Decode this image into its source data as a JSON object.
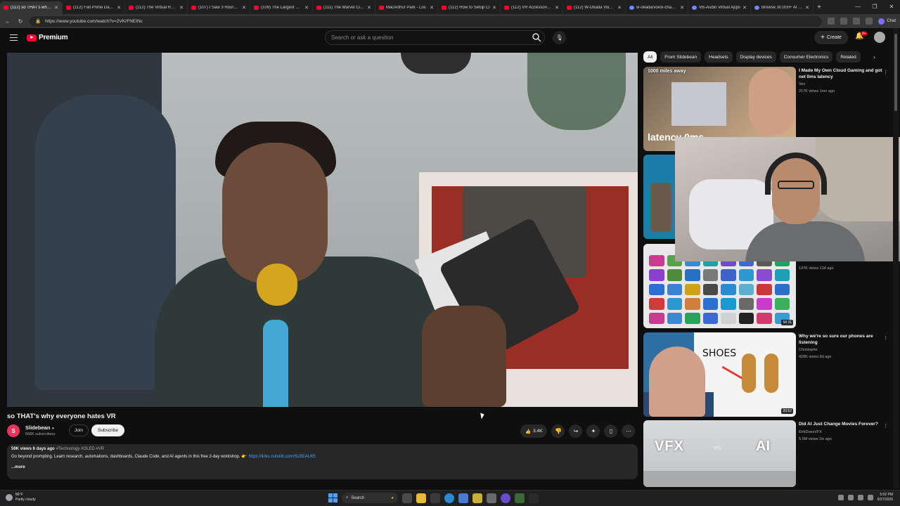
{
  "browser": {
    "tabs": [
      {
        "title": "(112) so THAT's why...",
        "active": true
      },
      {
        "title": "(112) Fall Prime Day vs"
      },
      {
        "title": "(112) The Virtual Reali"
      },
      {
        "title": "(107) I Saw 3 Hours of"
      },
      {
        "title": "(109) The Largest Econ"
      },
      {
        "title": "(111) The Marvel Circu"
      },
      {
        "title": "MacArthur Park - Los"
      },
      {
        "title": "(112) How to Setup Ci"
      },
      {
        "title": "(112) VR Accessories I"
      },
      {
        "title": "(112) W-Okada Voice C"
      },
      {
        "title": "w-okada/voice-changer"
      },
      {
        "title": "VB-Audio Virtual Apps"
      },
      {
        "title": "Browse 30,000+ AI Vo"
      }
    ],
    "new_tab": "+",
    "url": "https://www.youtube.com/watch?v=2VKrFNEINc",
    "chat_label": "Chat"
  },
  "header": {
    "logo_text": "Premium",
    "search_placeholder": "Search or ask a question",
    "create_label": "Create",
    "notif_count": "9+"
  },
  "video": {
    "title": "so THAT's why everyone hates VR",
    "channel": "Slidebean",
    "channel_initial": "S",
    "subscribers": "566K subscribers",
    "join_label": "Join",
    "subscribe_label": "Subscribe",
    "likes": "3.4K"
  },
  "description": {
    "meta": "59K views  6 days ago",
    "tags": "#Technology #OLED #VR",
    "text": "Go beyond prompting. Learn research, automations, dashboards, Claude Code, and AI agents in this free 2-day workshop. 👉",
    "link": "https://links.outskill.com/SLBEAU65",
    "more": "...more"
  },
  "chips": [
    "All",
    "From Slidebean",
    "Headsets",
    "Display devices",
    "Consumer Electronics",
    "Related"
  ],
  "recommendations": [
    {
      "title": "I Made My Own Cloud Gaming and got net 0ms latency",
      "channel": "Vex",
      "meta": "217K views  1mo ago",
      "thumb_label": "1000 miles away",
      "thumb_big": "latency 0ms"
    },
    {
      "title": "",
      "channel": "",
      "meta": ""
    },
    {
      "title": "",
      "channel": "",
      "meta": "137K views  13d ago",
      "duration": "58:31"
    },
    {
      "title": "Why we're so sure our phones are listening",
      "channel": "Christophe",
      "meta": "428K views  8d ago",
      "duration": "20:52",
      "thumb_word": "SHOES"
    },
    {
      "title": "Did AI Just Change Movies Forever?",
      "channel": "EnkDoesVFX",
      "meta": "5.5M views  2w ago",
      "thumb_left": "VFX",
      "thumb_vs": "vs",
      "thumb_right": "AI"
    }
  ],
  "taskbar": {
    "temp": "86°F",
    "weather": "Partly cloudy",
    "search_label": "Search",
    "time": "5:02 PM",
    "date": "6/27/2026"
  },
  "colors": {
    "accent": "#ff0033",
    "link": "#3ea6ff",
    "bg": "#0f0f0f"
  }
}
